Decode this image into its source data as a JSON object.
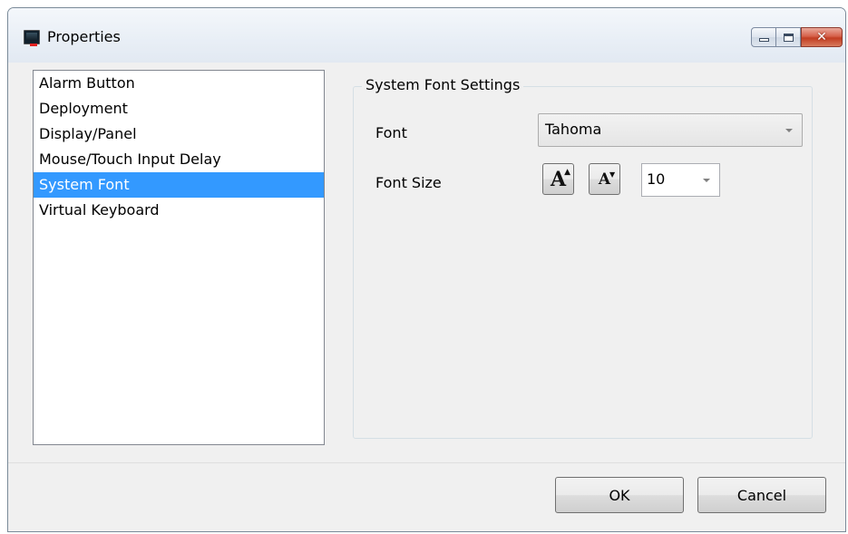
{
  "window": {
    "title": "Properties",
    "controls": {
      "minimize_icon": "minimize-icon",
      "maximize_icon": "maximize-icon",
      "close_glyph": "✕"
    }
  },
  "sidebar": {
    "items": [
      {
        "label": "Alarm Button",
        "selected": false
      },
      {
        "label": "Deployment",
        "selected": false
      },
      {
        "label": "Display/Panel",
        "selected": false
      },
      {
        "label": "Mouse/Touch Input Delay",
        "selected": false
      },
      {
        "label": "System Font",
        "selected": true
      },
      {
        "label": "Virtual Keyboard",
        "selected": false
      }
    ]
  },
  "settings": {
    "group_title": "System Font Settings",
    "font_label": "Font",
    "font_value": "Tahoma",
    "font_size_label": "Font Size",
    "font_size_value": "10",
    "increase_icon": "increase-font-size-icon",
    "decrease_icon": "decrease-font-size-icon"
  },
  "footer": {
    "ok_label": "OK",
    "cancel_label": "Cancel"
  },
  "colors": {
    "selection": "#3399ff",
    "close_button": "#c23d22",
    "window_bg": "#f0f0f0"
  }
}
